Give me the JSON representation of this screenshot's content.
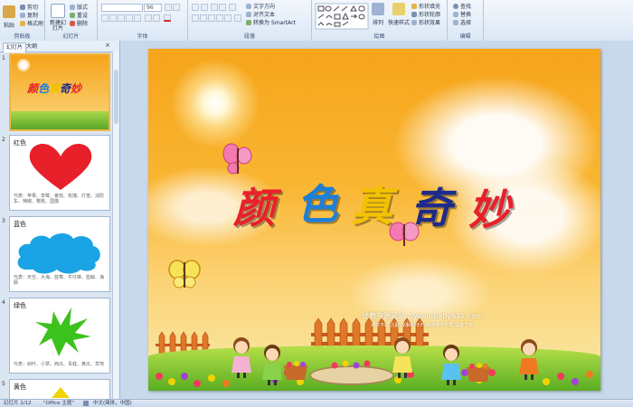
{
  "ribbon": {
    "clipboard": {
      "paste_label": "粘贴",
      "cut": "剪切",
      "copy": "复制",
      "format_painter": "格式刷",
      "group_label": "剪贴板"
    },
    "slides": {
      "new_slide_label": "新建幻灯片",
      "layout": "版式",
      "reset": "重设",
      "delete": "删除",
      "group_label": "幻灯片"
    },
    "font": {
      "size_value": "96",
      "group_label": "字体"
    },
    "paragraph": {
      "text_direction": "文字方向",
      "align_text": "对齐文本",
      "smartart": "转换为 SmartArt",
      "group_label": "段落"
    },
    "drawing": {
      "arrange": "排列",
      "quick_styles": "快速样式",
      "shape_fill": "形状填充",
      "shape_outline": "形状轮廓",
      "shape_effects": "形状效果",
      "group_label": "绘图"
    },
    "editing": {
      "find": "查找",
      "replace": "替换",
      "select": "选择",
      "group_label": "编辑"
    }
  },
  "panel": {
    "tabs": [
      "幻灯片",
      "大纲"
    ],
    "slides": [
      {
        "num": "1",
        "title": ""
      },
      {
        "num": "2",
        "title": "红色",
        "caption": "代表：苹果、草莓、番茄、玫瑰、灯笼、消防车、辣椒、樱桃、国旗"
      },
      {
        "num": "3",
        "title": "蓝色",
        "caption": "代表：天空、大海、蓝莓、牛仔裤、蓝鲸、海豚"
      },
      {
        "num": "4",
        "title": "绿色",
        "caption": "代表：树叶、小草、西瓜、青蛙、黄瓜、草地"
      },
      {
        "num": "5",
        "title": "黄色"
      }
    ]
  },
  "slide": {
    "title_chars": [
      "颜",
      "色",
      "真",
      "奇",
      "妙"
    ],
    "title_colors": [
      "#e8202a",
      "#1e7fd8",
      "#f2c200",
      "#1d2b8a",
      "#e8202a"
    ],
    "watermark": {
      "line1": "幼教资源网站  ziyuan.baby611.com",
      "line2": "课件下载  儿歌  故事MP3  FLASH课件下载  试卷下载"
    }
  },
  "status": {
    "slide_count": "幻灯片 1/12",
    "theme": "\"Office 主题\"",
    "language": "中文(简体，中国)"
  }
}
